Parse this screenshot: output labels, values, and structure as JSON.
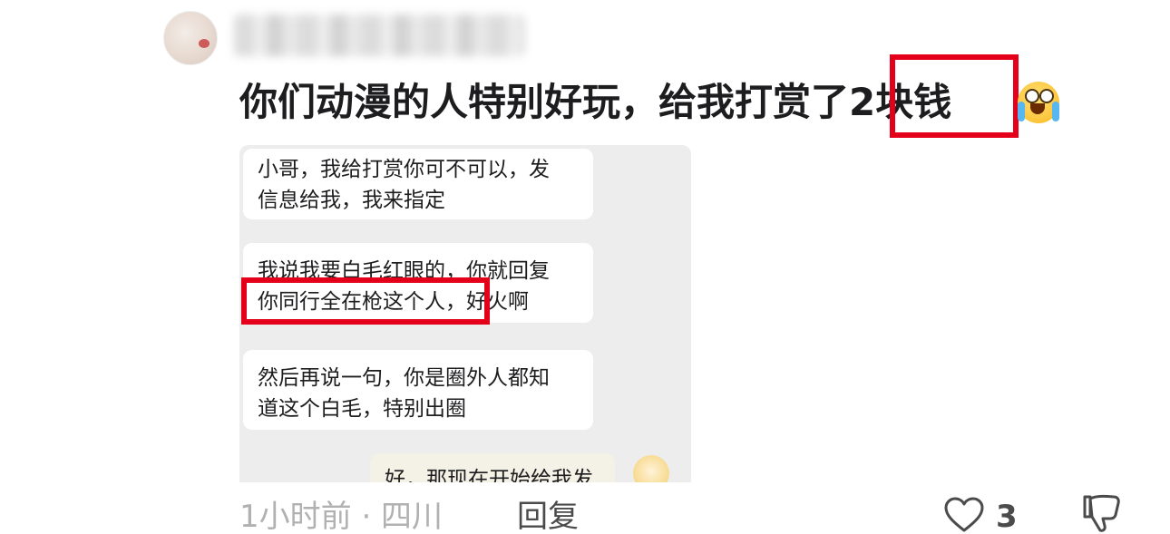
{
  "comment": {
    "username": "",
    "text": "你们动漫的人特别好玩，给我打赏了2块钱",
    "emoji": "crying-laughing-emoji"
  },
  "chat_screenshot": {
    "messages": [
      {
        "lines": [
          "小哥，我给打赏你可不可以，发",
          "信息给我，我来指定"
        ]
      },
      {
        "lines": [
          "我说我要白毛红眼的，你就回复",
          "你同行全在枪这个人，好火啊"
        ]
      },
      {
        "lines": [
          "然后再说一句，你是圈外人都知",
          "道这个白毛，特别出圈"
        ]
      },
      {
        "lines": [
          "好，那现在开始给我发"
        ]
      }
    ]
  },
  "footer": {
    "meta": "1小时前 · 四川",
    "reply_label": "回复",
    "like_count": "3"
  },
  "colors": {
    "highlight": "#e4001b",
    "chat_bg": "#ededed",
    "text_dark": "#1d1d1f",
    "meta_gray": "#b1b1b1"
  }
}
